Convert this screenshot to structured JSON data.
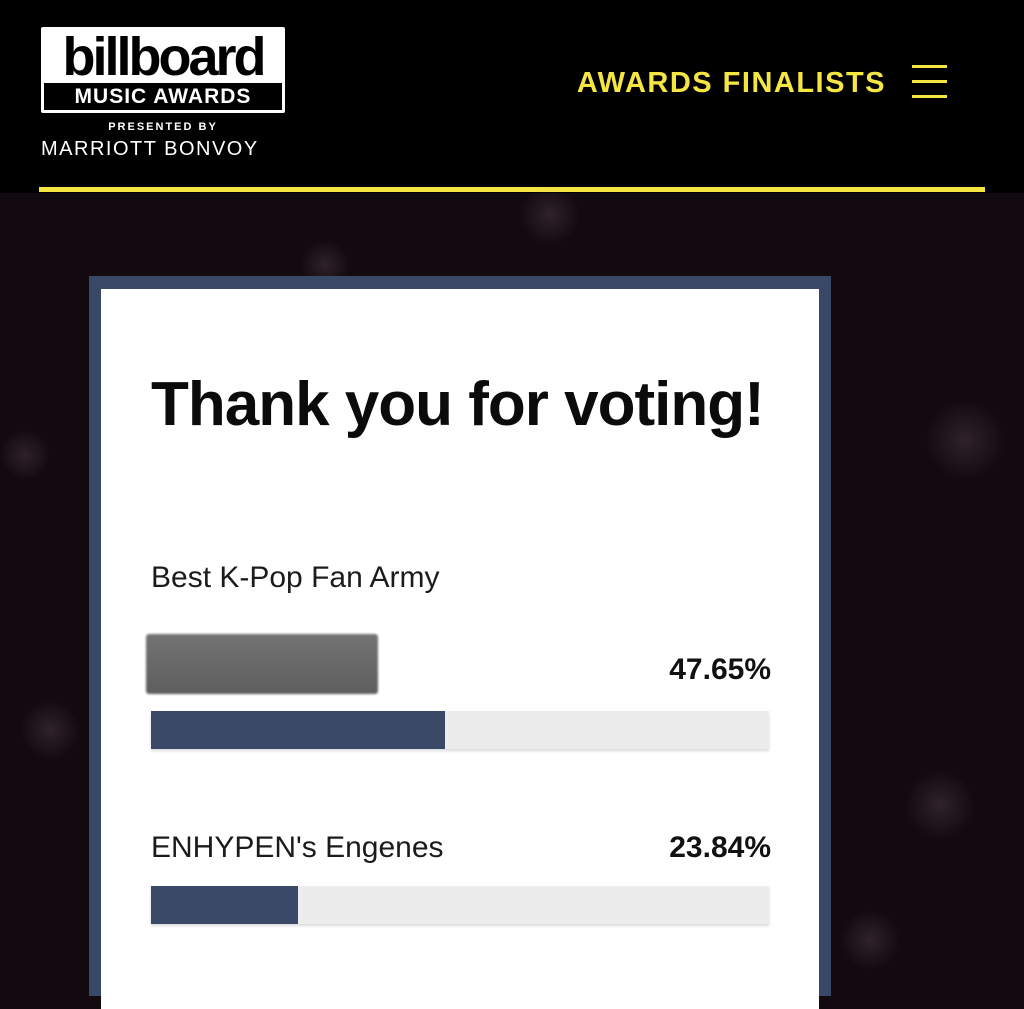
{
  "header": {
    "logo": {
      "wordmark": "billboard",
      "subtitle": "MUSIC AWARDS",
      "presented_by": "PRESENTED BY",
      "sponsor": "MARRIOTT BONVOY"
    },
    "nav_link": "AWARDS FINALISTS",
    "menu_icon": "hamburger-menu-icon"
  },
  "card": {
    "title": "Thank you for voting!",
    "category": "Best K-Pop Fan Army",
    "results": [
      {
        "name": "",
        "percent_label": "47.65%",
        "percent": 47.65,
        "redacted": true
      },
      {
        "name": "ENHYPEN's Engenes",
        "percent_label": "23.84%",
        "percent": 23.84,
        "redacted": false
      }
    ]
  },
  "colors": {
    "accent_yellow": "#f5e642",
    "bar_fill": "#3a4868",
    "bar_track": "#ececec",
    "header_bg": "#000000",
    "page_bg": "#130a0f"
  }
}
